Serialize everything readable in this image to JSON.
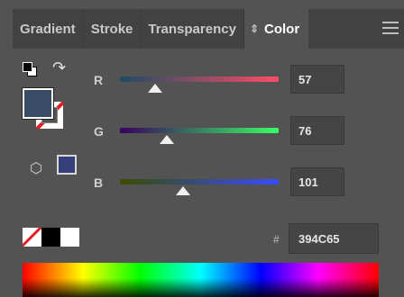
{
  "tabs": [
    {
      "label": "Gradient"
    },
    {
      "label": "Stroke"
    },
    {
      "label": "Transparency"
    },
    {
      "label": "Color",
      "active": true
    }
  ],
  "sliders": [
    {
      "label": "R",
      "value": "57",
      "level": 0.224,
      "gradient": [
        "#1e4c65",
        "#ff4c65"
      ]
    },
    {
      "label": "G",
      "value": "76",
      "level": 0.298,
      "gradient": [
        "#39005f",
        "#39ff65"
      ]
    },
    {
      "label": "B",
      "value": "101",
      "level": 0.396,
      "gradient": [
        "#394c00",
        "#394cff"
      ]
    }
  ],
  "hex": {
    "symbol": "#",
    "value": "394C65"
  },
  "colors": {
    "fill": "#394c65",
    "gamut_warning": "#35407a",
    "panel_bg": "#535353",
    "tabbar_bg": "#424242"
  },
  "icons": {
    "default_colors": "default-fill-stroke-icon",
    "swap": "swap-fill-stroke-icon",
    "cube": "out-of-web-color-cube-icon",
    "menu": "panel-menu-icon"
  }
}
